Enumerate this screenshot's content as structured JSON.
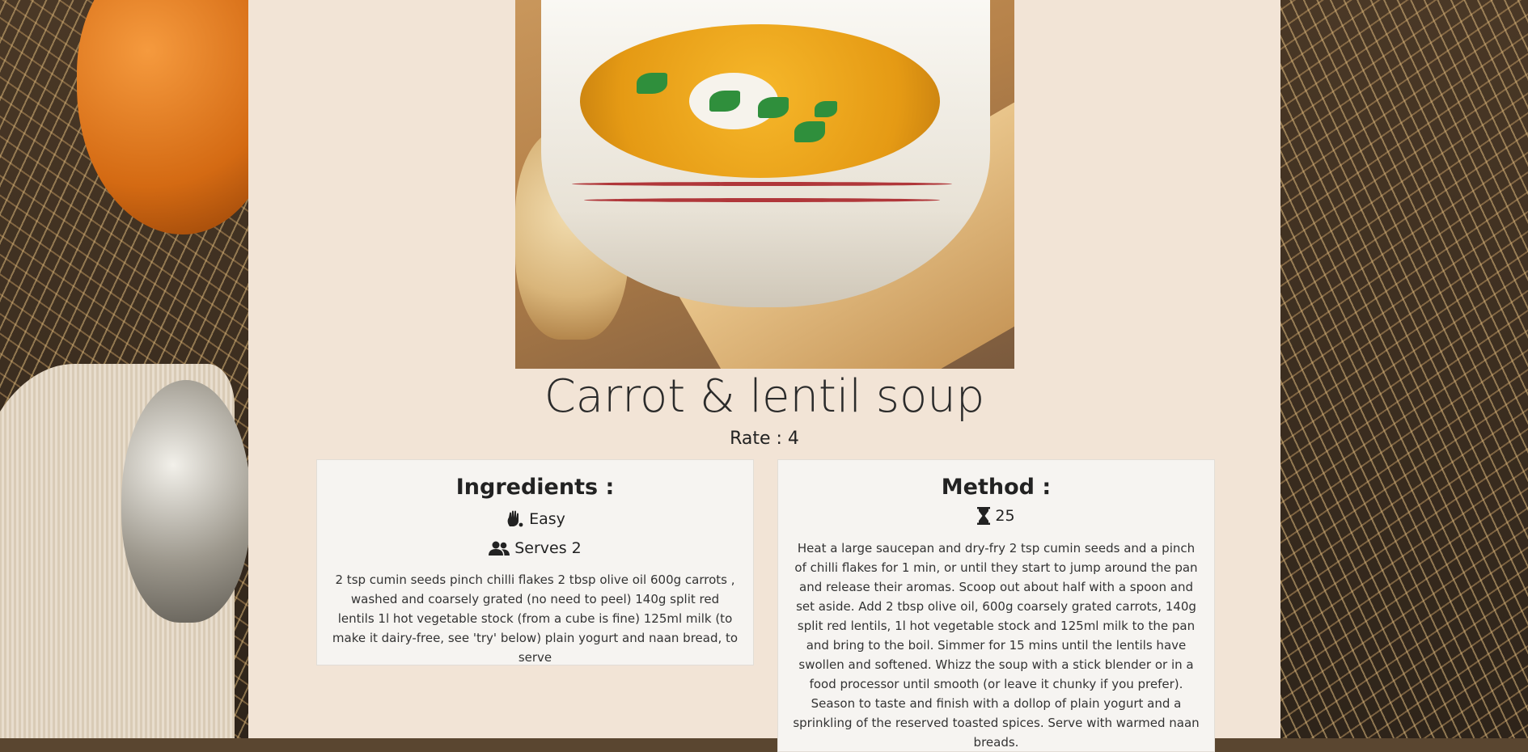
{
  "recipe": {
    "title": "Carrot & lentil soup",
    "rate": "Rate : 4"
  },
  "ingredients": {
    "heading": "Ingredients :",
    "difficulty_label": "Easy",
    "serves_label": "Serves 2",
    "text": "2 tsp cumin seeds pinch chilli flakes 2 tbsp olive oil 600g carrots , washed and coarsely grated (no need to peel) 140g split red lentils 1l hot vegetable stock (from a cube is fine) 125ml milk (to make it dairy-free, see 'try' below) plain yogurt and naan bread, to serve"
  },
  "method": {
    "heading": "Method :",
    "time_label": "25",
    "text": "Heat a large saucepan and dry-fry 2 tsp cumin seeds and a pinch of chilli flakes for 1 min, or until they start to jump around the pan and release their aromas. Scoop out about half with a spoon and set aside. Add 2 tbsp olive oil, 600g coarsely grated carrots, 140g split red lentils, 1l hot vegetable stock and 125ml milk to the pan and bring to the boil. Simmer for 15 mins until the lentils have swollen and softened. Whizz the soup with a stick blender or in a food processor until smooth (or leave it chunky if you prefer). Season to taste and finish with a dollop of plain yogurt and a sprinkling of the reserved toasted spices. Serve with warmed naan breads."
  },
  "icons": {
    "difficulty": "hand-icon",
    "serves": "users-icon",
    "time": "hourglass-icon"
  },
  "colors": {
    "panel_bg": "#f2e4d6",
    "card_bg": "#f6f4f1",
    "text": "#222222"
  }
}
